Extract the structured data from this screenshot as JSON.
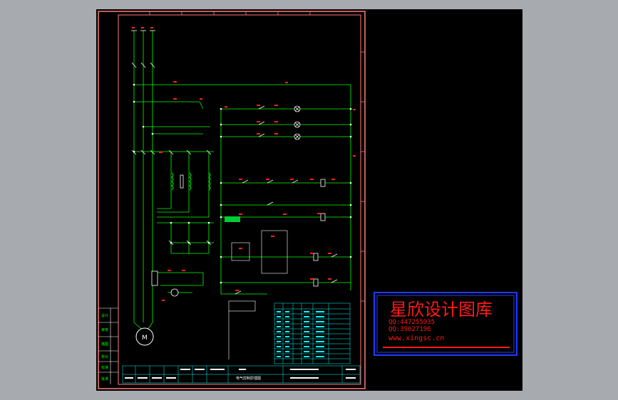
{
  "colors": {
    "canvas": "#000000",
    "outside": "#a7aaae",
    "border": "#ff7a7a",
    "frame": "#ffffff",
    "wire": "#00ff00",
    "label": "#ff2020",
    "table": "#00ffff",
    "watermark_frame": "#1e3cff",
    "watermark_text": "#ff1a1a"
  },
  "watermark": {
    "title": "星欣设计图库",
    "qq1": "QQ:447255935",
    "qq2": "QQ:39627196",
    "site": "www.xingsc.cn"
  },
  "motor": {
    "symbol": "M"
  },
  "titleblock": {
    "drawing_name": "电气控制原理图",
    "side_labels": [
      "设计",
      "审核",
      "描图",
      "校对",
      "标准",
      "批准"
    ]
  }
}
